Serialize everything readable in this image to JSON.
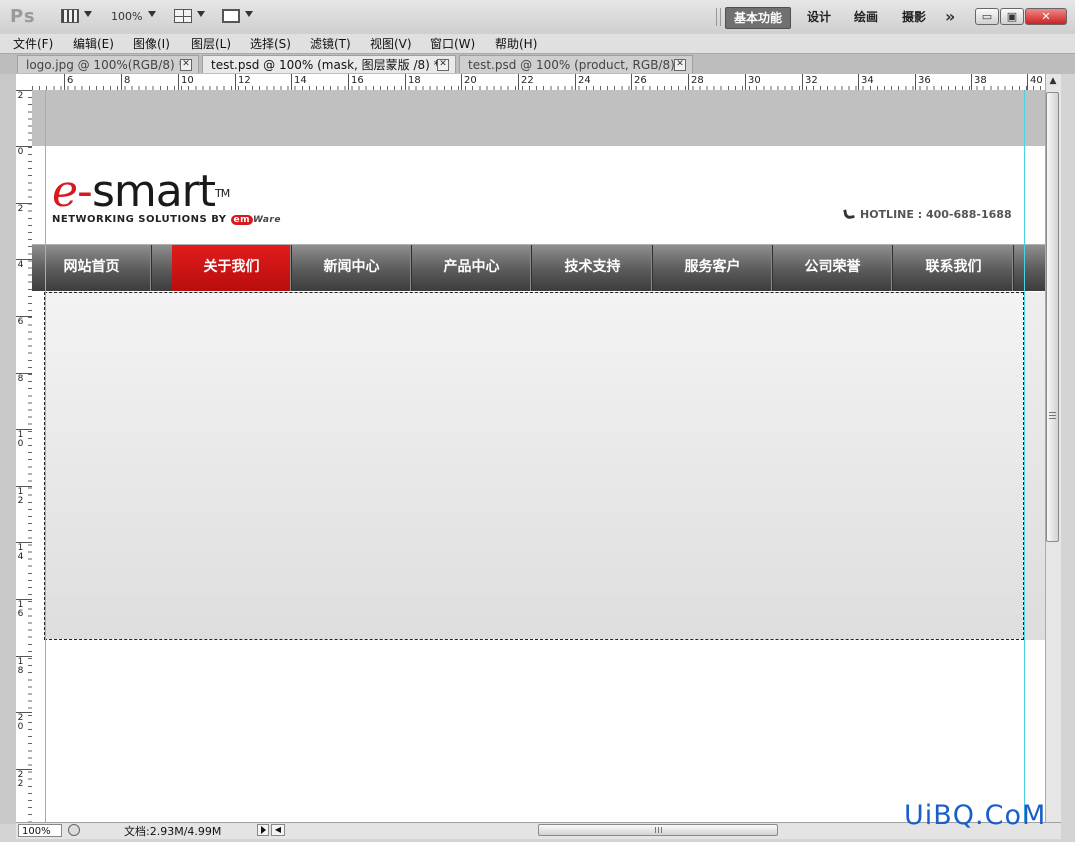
{
  "app": {
    "logo": "Ps",
    "zoom": "100%",
    "workspaces": [
      "基本功能",
      "设计",
      "绘画",
      "摄影"
    ],
    "more": "»",
    "window_buttons": {
      "minimize": "▭",
      "restore": "▣",
      "close": "✕"
    }
  },
  "menu": [
    "文件(F)",
    "编辑(E)",
    "图像(I)",
    "图层(L)",
    "选择(S)",
    "滤镜(T)",
    "视图(V)",
    "窗口(W)",
    "帮助(H)"
  ],
  "tabs": [
    {
      "label": "logo.jpg @ 100%(RGB/8) *",
      "active": false
    },
    {
      "label": "test.psd @ 100% (mask, 图层蒙版 /8) *",
      "active": true
    },
    {
      "label": "test.psd @ 100% (product, RGB/8) *",
      "active": false
    }
  ],
  "tab_close": "✕",
  "ruler": {
    "horizontal": [
      "6",
      "8",
      "10",
      "12",
      "14",
      "16",
      "18",
      "20",
      "22",
      "24",
      "26",
      "28",
      "30",
      "32",
      "34",
      "36",
      "38",
      "40"
    ],
    "vertical": [
      "2",
      "0",
      "2",
      "4",
      "6",
      "8",
      "10",
      "12",
      "14",
      "16",
      "18",
      "20",
      "22"
    ]
  },
  "site": {
    "logo_e": "e",
    "logo_dash": "-",
    "logo_word": "smart",
    "logo_tm": "TM",
    "tagline": "NETWORKING SOLUTIONS BY",
    "emware_badge": "em",
    "emware_text": "Ware",
    "hotline": "HOTLINE : 400-688-1688",
    "nav": [
      {
        "label": "网站首页",
        "active": false
      },
      {
        "label": "关于我们",
        "active": true
      },
      {
        "label": "新闻中心",
        "active": false
      },
      {
        "label": "产品中心",
        "active": false
      },
      {
        "label": "技术支持",
        "active": false
      },
      {
        "label": "服务客户",
        "active": false
      },
      {
        "label": "公司荣誉",
        "active": false
      },
      {
        "label": "联系我们",
        "active": false
      }
    ]
  },
  "status": {
    "zoom": "100%",
    "doc_info": "文档:2.93M/4.99M"
  },
  "watermark": "UiBQ.CoM",
  "colors": {
    "accent_red": "#d71920",
    "nav_dark": "#4a4a4a",
    "guide_cyan": "#48d4e6",
    "watermark_blue": "#1a5fc8"
  }
}
